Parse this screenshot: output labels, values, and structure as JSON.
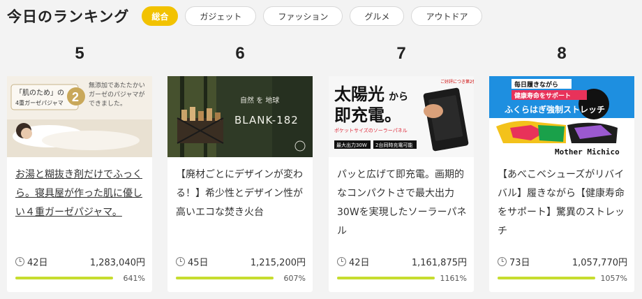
{
  "header": {
    "title": "今日のランキング",
    "tabs": [
      {
        "label": "総合",
        "active": true
      },
      {
        "label": "ガジェット",
        "active": false
      },
      {
        "label": "ファッション",
        "active": false
      },
      {
        "label": "グルメ",
        "active": false
      },
      {
        "label": "アウトドア",
        "active": false
      }
    ]
  },
  "colors": {
    "accent": "#f2c200",
    "progress": "#c7dd2f",
    "background": "#f3f3f3"
  },
  "items": [
    {
      "rank": "5",
      "image": {
        "lines": [
          "「肌のため」の",
          "4重ガーゼパジャマ",
          "無添加であたたかい",
          "ガーゼのパジャマが",
          "できました。"
        ],
        "badge": "2"
      },
      "description": "お湯と糊抜き剤だけでふっくら。寝具屋が作った肌に優しい４重ガーゼパジャマ。",
      "days": "42日",
      "amount": "1,283,040円",
      "percent": "641%",
      "progress": 1.0
    },
    {
      "rank": "6",
      "image": {
        "lines": [
          "自然 を 地球",
          "BLANK-182"
        ]
      },
      "description": "【廃材ごとにデザインが変わる！】希少性とデザイン性が高いエコな焚き火台",
      "days": "45日",
      "amount": "1,215,200円",
      "percent": "607%",
      "progress": 1.0
    },
    {
      "rank": "7",
      "image": {
        "lines": [
          "太陽光",
          "から",
          "即充電。",
          "ポケットサイズのソーラーパネル",
          "最大出力30W",
          "2台同時充電可能"
        ]
      },
      "description": "パッと広げて即充電。画期的なコンパクトさで最大出力30Wを実現したソーラーパネル",
      "days": "42日",
      "amount": "1,161,875円",
      "percent": "1161%",
      "progress": 1.0
    },
    {
      "rank": "8",
      "image": {
        "lines": [
          "毎日履きながら",
          "健康寿命をサポート",
          "ふくらはぎ強制ストレッチ",
          "Mother Michico"
        ]
      },
      "description": "【あべこベシューズがリバイバル】履きながら【健康寿命をサポート】驚異のストレッチ",
      "days": "73日",
      "amount": "1,057,770円",
      "percent": "1057%",
      "progress": 1.0
    }
  ]
}
